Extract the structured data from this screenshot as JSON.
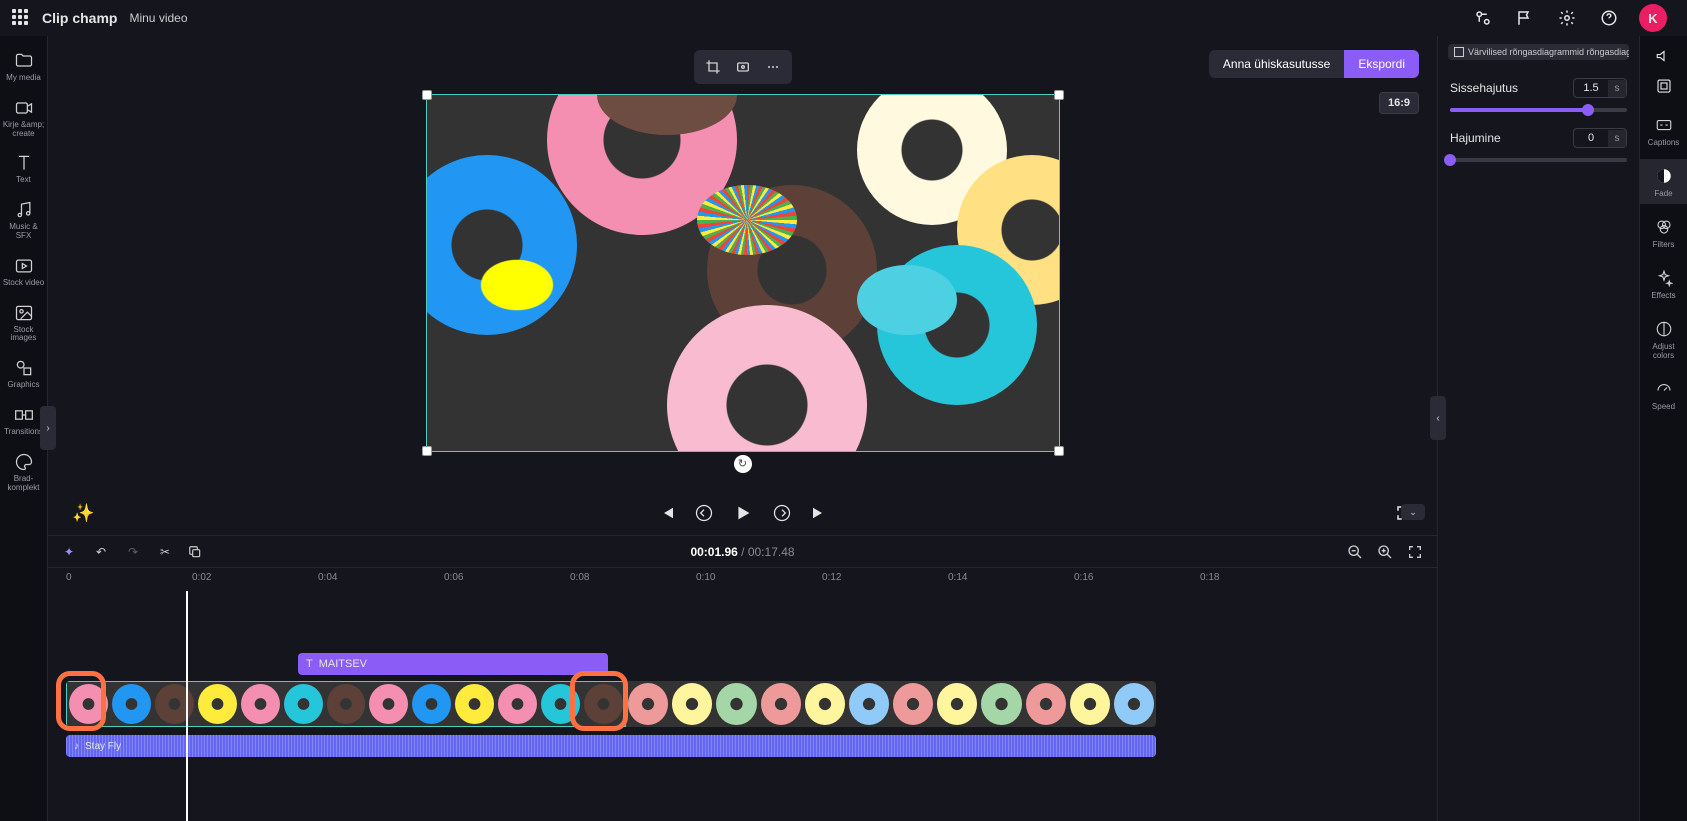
{
  "app": {
    "name": "Clip champ",
    "project": "Minu video"
  },
  "avatar": {
    "initial": "K"
  },
  "left_sidebar": [
    {
      "id": "my-media",
      "label": "My media"
    },
    {
      "id": "record",
      "label": "Kirje &amp; create"
    },
    {
      "id": "text",
      "label": "Text"
    },
    {
      "id": "music",
      "label": "Music & SFX"
    },
    {
      "id": "stock-video",
      "label": "Stock video"
    },
    {
      "id": "stock-images",
      "label": "Stock images"
    },
    {
      "id": "graphics",
      "label": "Graphics"
    },
    {
      "id": "transitions",
      "label": "Transitions"
    },
    {
      "id": "brand-kit",
      "label": "Brad-komplekt"
    }
  ],
  "actions": {
    "share": "Anna ühiskasutusse",
    "export": "Ekspordi",
    "aspect": "16:9"
  },
  "playback": {
    "current": "00:01.96",
    "total": "00:17.48"
  },
  "ruler": [
    "0",
    "0:02",
    "0:04",
    "0:06",
    "0:08",
    "0:10",
    "0:12",
    "0:14",
    "0:16",
    "0:18"
  ],
  "text_clip": {
    "label": "MAITSEV"
  },
  "audio_clip": {
    "label": "Stay Fly"
  },
  "right_panel": {
    "chip": "Värvilised rõngasdiagrammid rõngasdiagrammidega",
    "fade_in": {
      "label": "Sissehajutus",
      "value": "1.5",
      "unit": "s",
      "pct": 78
    },
    "fade_out": {
      "label": "Hajumine",
      "value": "0",
      "unit": "s",
      "pct": 0
    }
  },
  "right_tabs": [
    {
      "id": "captions",
      "label": "Captions"
    },
    {
      "id": "fade",
      "label": "Fade",
      "active": true
    },
    {
      "id": "filters",
      "label": "Filters"
    },
    {
      "id": "effects",
      "label": "Effects"
    },
    {
      "id": "adjust",
      "label": "Adjust colors"
    },
    {
      "id": "speed",
      "label": "Speed"
    }
  ]
}
